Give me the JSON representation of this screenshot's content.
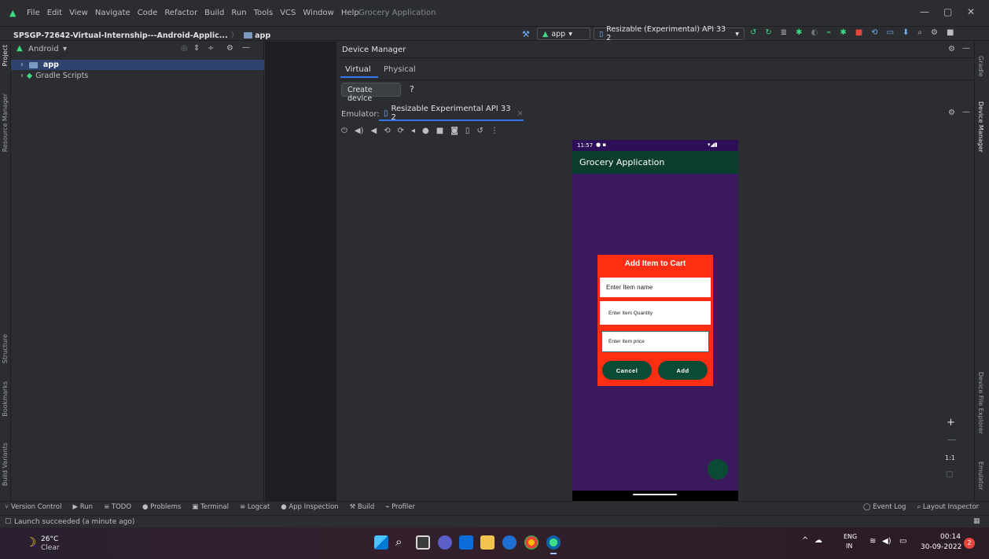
{
  "menubar": {
    "items": [
      "File",
      "Edit",
      "View",
      "Navigate",
      "Code",
      "Refactor",
      "Build",
      "Run",
      "Tools",
      "VCS",
      "Window",
      "Help"
    ],
    "app_title": "Grocery Application",
    "window_controls": [
      "—",
      "▢",
      "✕"
    ]
  },
  "navbar": {
    "project": "SPSGP-72642-Virtual-Internship---Android-Applic...",
    "module": "app",
    "run_config": "app",
    "device": "Resizable (Experimental) API 33 2"
  },
  "left_strip": {
    "tabs": [
      "Project",
      "Resource Manager",
      "Structure",
      "Bookmarks",
      "Build Variants"
    ]
  },
  "project_panel": {
    "view_mode": "Android",
    "tree": [
      {
        "label": "app",
        "selected": true
      },
      {
        "label": "Gradle Scripts",
        "selected": false
      }
    ]
  },
  "device_manager": {
    "title": "Device Manager",
    "tabs": [
      "Virtual",
      "Physical"
    ],
    "create_button": "Create device",
    "help": "?"
  },
  "emulator": {
    "label": "Emulator:",
    "tab": "Resizable Experimental API 33 2",
    "close": "×",
    "zoom_label": "1:1"
  },
  "phone": {
    "time": "11:57",
    "app_title": "Grocery Application",
    "dialog": {
      "title": "Add Item to Cart",
      "name_hint": "Enter Item name",
      "quantity_hint": "Enter Item Quantity",
      "price_hint": "Enter Item price",
      "cancel": "Cancel",
      "add": "Add"
    }
  },
  "right_strip": {
    "tabs": [
      "Gradle",
      "Device Manager",
      "Device File Explorer",
      "Emulator"
    ]
  },
  "tool_windows": {
    "items": [
      "Version Control",
      "Run",
      "TODO",
      "Problems",
      "Terminal",
      "Logcat",
      "App Inspection",
      "Build",
      "Profiler"
    ],
    "right_items": [
      "Event Log",
      "Layout Inspector"
    ]
  },
  "status": {
    "message": "Launch succeeded (a minute ago)"
  },
  "taskbar": {
    "temperature": "26°C",
    "weather": "Clear",
    "lang": "ENG",
    "region": "IN",
    "time": "00:14",
    "date": "30-09-2022",
    "notifications": "2"
  }
}
